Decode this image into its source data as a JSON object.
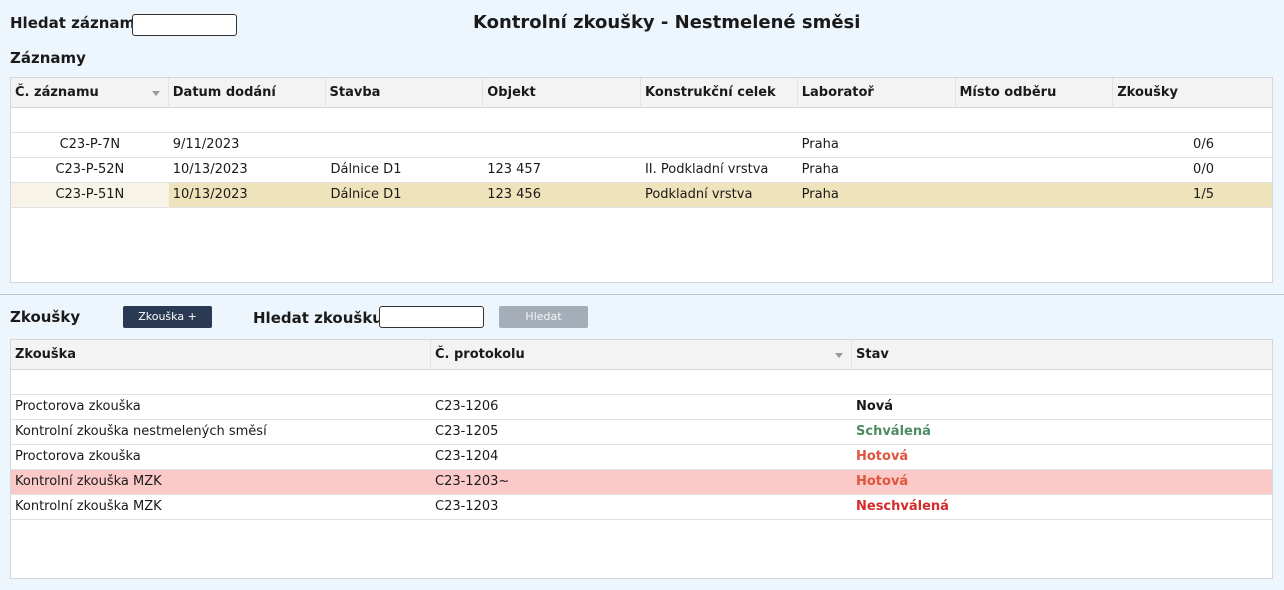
{
  "header": {
    "search_label": "Hledat záznam",
    "search_value": "",
    "title": "Kontrolní zkoušky - Nestmelené směsi"
  },
  "records": {
    "heading": "Záznamy",
    "columns": [
      "Č. záznamu",
      "Datum dodání",
      "Stavba",
      "Objekt",
      "Konstrukční celek",
      "Laboratoř",
      "Místo odběru",
      "Zkoušky"
    ],
    "rows": [
      {
        "id": "C23-P-7N",
        "date": "9/11/2023",
        "stavba": "",
        "objekt": "",
        "celek": "",
        "lab": "Praha",
        "misto": "",
        "zkousky": "0/6"
      },
      {
        "id": "C23-P-52N",
        "date": "10/13/2023",
        "stavba": "Dálnice D1",
        "objekt": "123 457",
        "celek": "II. Podkladní vrstva",
        "lab": "Praha",
        "misto": "",
        "zkousky": "0/0"
      },
      {
        "id": "C23-P-51N",
        "date": "10/13/2023",
        "stavba": "Dálnice D1",
        "objekt": "123 456",
        "celek": "Podkladní vrstva",
        "lab": "Praha",
        "misto": "",
        "zkousky": "1/5"
      }
    ]
  },
  "tests": {
    "heading": "Zkoušky",
    "add_button": "Zkouška +",
    "search_label": "Hledat zkoušku",
    "search_value": "",
    "search_button": "Hledat",
    "columns": [
      "Zkouška",
      "Č. protokolu",
      "Stav"
    ],
    "rows": [
      {
        "name": "Proctorova zkouška",
        "protocol": "C23-1206",
        "status": "Nová"
      },
      {
        "name": "Kontrolní zkouška nestmelených směsí",
        "protocol": "C23-1205",
        "status": "Schválená"
      },
      {
        "name": "Proctorova zkouška",
        "protocol": "C23-1204",
        "status": "Hotová"
      },
      {
        "name": "Kontrolní zkouška MZK",
        "protocol": "C23-1203~",
        "status": "Hotová"
      },
      {
        "name": "Kontrolní zkouška MZK",
        "protocol": "C23-1203",
        "status": "Neschválená"
      }
    ]
  },
  "colors": {
    "status_new": "#1a1a1a",
    "status_approved": "#4e8a62",
    "status_done": "#e0553c",
    "status_rejected": "#d42b2b",
    "selected_row": "#efe3bb",
    "highlight_row": "#fcc9c9",
    "primary_button": "#2a3a52",
    "disabled_button": "#a5adb8"
  }
}
